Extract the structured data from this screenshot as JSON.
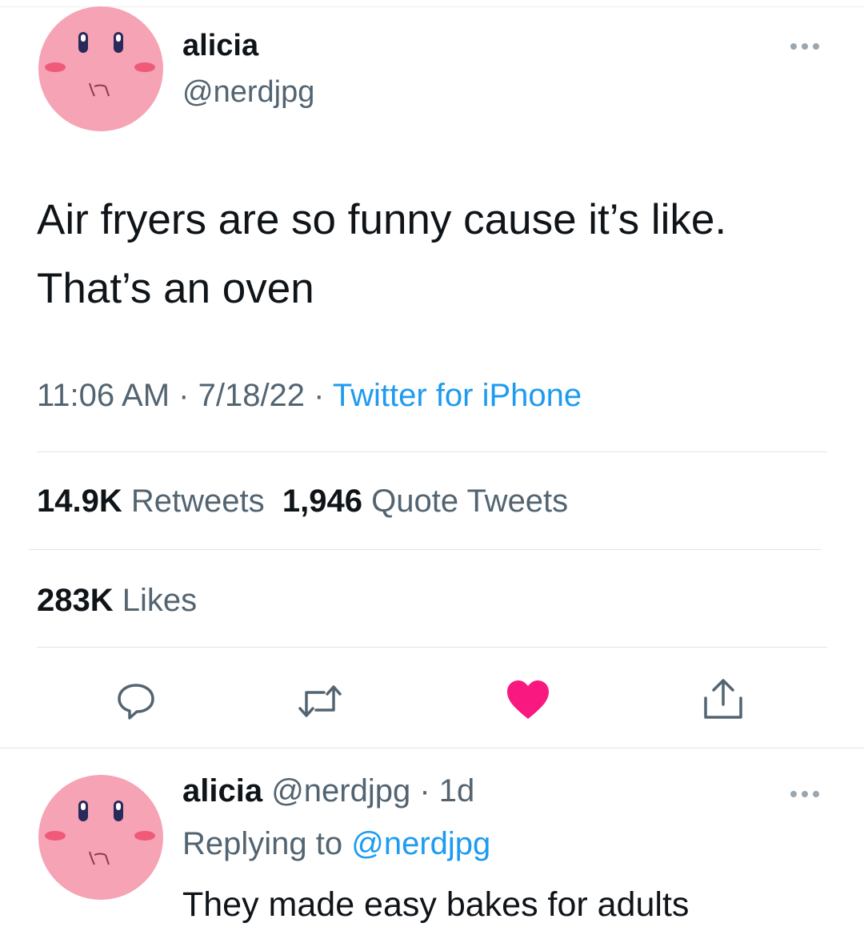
{
  "tweet": {
    "author_name": "alicia",
    "author_handle": "@nerdjpg",
    "text": "Air fryers are so funny cause it’s like. That’s an oven",
    "time": "11:06 AM",
    "date": "7/18/22",
    "source": "Twitter for iPhone",
    "separator": " · ",
    "stats": {
      "retweets_count": "14.9K",
      "retweets_label": "Retweets",
      "quotes_count": "1,946",
      "quotes_label": "Quote Tweets",
      "likes_count": "283K",
      "likes_label": "Likes"
    },
    "liked": true
  },
  "reply": {
    "author_name": "alicia",
    "author_handle": "@nerdjpg",
    "age": "1d",
    "separator": " · ",
    "replying_to_label": "Replying to",
    "replying_to_handle": "@nerdjpg",
    "text": "They made easy bakes for adults"
  },
  "icons": {
    "avatar": "kirby-avatar",
    "more": "more-horizontal-icon",
    "reply": "reply-bubble-icon",
    "retweet": "retweet-icon",
    "like": "heart-icon",
    "share": "share-icon"
  },
  "colors": {
    "link": "#1d9bf0",
    "like": "#f91880",
    "muted": "#536471",
    "text": "#0f1419",
    "avatar": "#f5a3b5"
  }
}
